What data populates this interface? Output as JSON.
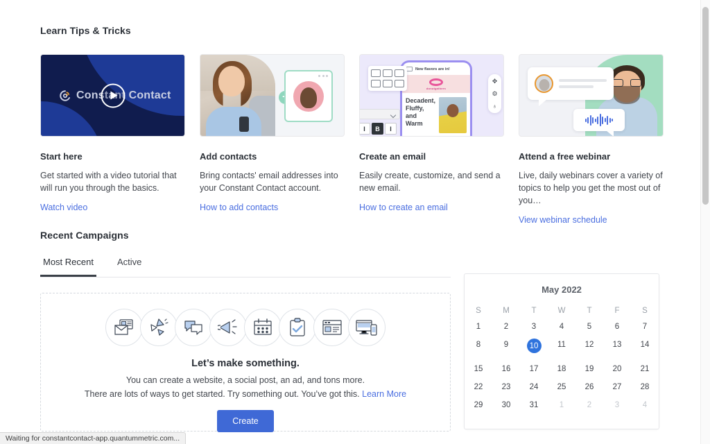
{
  "sections": {
    "tips_heading": "Learn Tips & Tricks",
    "campaigns_heading": "Recent Campaigns"
  },
  "tips": [
    {
      "title": "Start here",
      "desc": "Get started with a video tutorial that will run you through the basics.",
      "link": "Watch video",
      "media": "video-thumbnail",
      "brand_text": "Constant Contact",
      "play_icon": "play-icon"
    },
    {
      "title": "Add contacts",
      "desc": "Bring contacts' email addresses into your Constant Contact account.",
      "link": "How to add contacts",
      "media": "add-contacts-illustration",
      "plus_icon": "plus-icon"
    },
    {
      "title": "Create an email",
      "desc": "Easily create, customize, and send a new email.",
      "link": "How to create an email",
      "media": "email-builder-illustration",
      "email_subject": "New flavors are in!",
      "email_brand": "donutgathern",
      "email_headline": "Decadent, Fluffy, and Warm",
      "bold_label": "B",
      "italic_label": "I"
    },
    {
      "title": "Attend a free webinar",
      "desc": "Live, daily webinars cover a variety of topics to help you get the most out of you…",
      "link": "View webinar schedule",
      "media": "webinar-illustration"
    }
  ],
  "tabs": [
    {
      "label": "Most Recent",
      "active": true
    },
    {
      "label": "Active",
      "active": false
    }
  ],
  "empty_state": {
    "icons": [
      "email-envelope-icon",
      "paper-planes-icon",
      "chat-bubbles-icon",
      "megaphone-icon",
      "calendar-icon",
      "clipboard-check-icon",
      "webpage-icon",
      "devices-icon"
    ],
    "heading": "Let’s make something.",
    "line1": "You can create a website, a social post, an ad, and tons more.",
    "line2": "There are lots of ways to get started. Try something out. You’ve got this.",
    "learn_more": "Learn More",
    "create_button": "Create"
  },
  "calendar": {
    "title": "May 2022",
    "dow": [
      "S",
      "M",
      "T",
      "W",
      "T",
      "F",
      "S"
    ],
    "weeks": [
      [
        {
          "d": "1"
        },
        {
          "d": "2"
        },
        {
          "d": "3"
        },
        {
          "d": "4"
        },
        {
          "d": "5"
        },
        {
          "d": "6"
        },
        {
          "d": "7"
        }
      ],
      [
        {
          "d": "8"
        },
        {
          "d": "9"
        },
        {
          "d": "10",
          "selected": true
        },
        {
          "d": "11"
        },
        {
          "d": "12"
        },
        {
          "d": "13"
        },
        {
          "d": "14"
        }
      ],
      [
        {
          "d": "15"
        },
        {
          "d": "16"
        },
        {
          "d": "17"
        },
        {
          "d": "18"
        },
        {
          "d": "19"
        },
        {
          "d": "20"
        },
        {
          "d": "21"
        }
      ],
      [
        {
          "d": "22"
        },
        {
          "d": "23"
        },
        {
          "d": "24"
        },
        {
          "d": "25"
        },
        {
          "d": "26"
        },
        {
          "d": "27"
        },
        {
          "d": "28"
        }
      ],
      [
        {
          "d": "29"
        },
        {
          "d": "30"
        },
        {
          "d": "31"
        },
        {
          "d": "1",
          "muted": true
        },
        {
          "d": "2",
          "muted": true
        },
        {
          "d": "3",
          "muted": true
        },
        {
          "d": "4",
          "muted": true
        }
      ]
    ],
    "selected_day": "10"
  },
  "status_bar": {
    "text": "Waiting for constantcontact-app.quantummetric.com..."
  },
  "colors": {
    "link": "#4a6ee0",
    "button": "#3f69d6",
    "selected_day": "#2f73dd",
    "video_bg": "#101c4e",
    "tab_underline": "#3a4048"
  }
}
